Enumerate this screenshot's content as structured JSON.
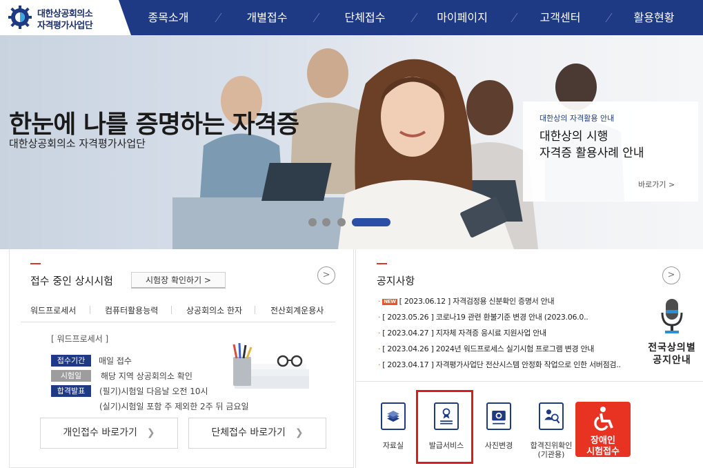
{
  "header": {
    "logo_line1": "대한상공회의소",
    "logo_line2": "자격평가사업단",
    "nav": [
      "종목소개",
      "개별접수",
      "단체접수",
      "마이페이지",
      "고객센터",
      "활용현황"
    ]
  },
  "hero": {
    "title": "한눈에 나를 증명하는 자격증",
    "subtitle": "대한상공회의소 자격평가사업단",
    "card": {
      "kicker": "대한상의 자격활용 안내",
      "title_line1": "대한상의 시행",
      "title_line2": "자격증 활용사례 안내",
      "more": "바로가기 >"
    },
    "slide_count": 4,
    "active_slide": 4
  },
  "exam": {
    "title": "접수 중인 상시시험",
    "check_button": "시험장 확인하기 >",
    "more": ">",
    "tabs": [
      "워드프로세서",
      "컴퓨터활용능력",
      "상공회의소 한자",
      "전산회계운용사"
    ],
    "selected": "[ 워드프로세서 ]",
    "rows": [
      {
        "badge": "접수기간",
        "text": "매일 접수"
      },
      {
        "badge": "시험일",
        "text": "해당 지역 상공회의소 확인"
      },
      {
        "badge": "합격발표",
        "text": "(필기)시험일 다음날 오전 10시"
      }
    ],
    "extra_line": "(실기)시험일 포함 주 제외한 2주 뒤 금요일",
    "btn_individual": "개인접수 바로가기",
    "btn_group": "단체접수 바로가기"
  },
  "notice": {
    "title": "공지사항",
    "more": ">",
    "new_label": "NEW",
    "items": [
      {
        "date": "[ 2023.06.12 ]",
        "text": "자격검정용 신분확인 증명서 안내",
        "is_new": true
      },
      {
        "date": "[ 2023.05.26 ]",
        "text": "코로나19 관련 환불기준 변경 안내 (2023.06.0..",
        "is_new": false
      },
      {
        "date": "[ 2023.04.27 ]",
        "text": "지자체 자격증 응시료 지원사업 안내",
        "is_new": false
      },
      {
        "date": "[ 2023.04.26 ]",
        "text": "2024년 워드프로세스 실기시험 프로그램 변경 안내",
        "is_new": false
      },
      {
        "date": "[ 2023.04.17 ]",
        "text": "자격평가사업단 전산시스템 안정화 작업으로 인한 서버점검..",
        "is_new": false
      }
    ],
    "mic_line1": "전국상의별",
    "mic_line2": "공지안내"
  },
  "quick": {
    "items": [
      {
        "label": "자료실",
        "icon": "stack-icon"
      },
      {
        "label": "발급서비스",
        "icon": "certificate-icon"
      },
      {
        "label": "사진변경",
        "icon": "camera-icon"
      },
      {
        "label": "합격진위확인\n(기관용)",
        "icon": "verify-person-icon"
      }
    ],
    "disabled_line1": "장애인",
    "disabled_line2": "시험접수"
  },
  "colors": {
    "brand_navy": "#1e3a84",
    "accent_red": "#e83222",
    "highlight_red": "#e01a1a"
  }
}
